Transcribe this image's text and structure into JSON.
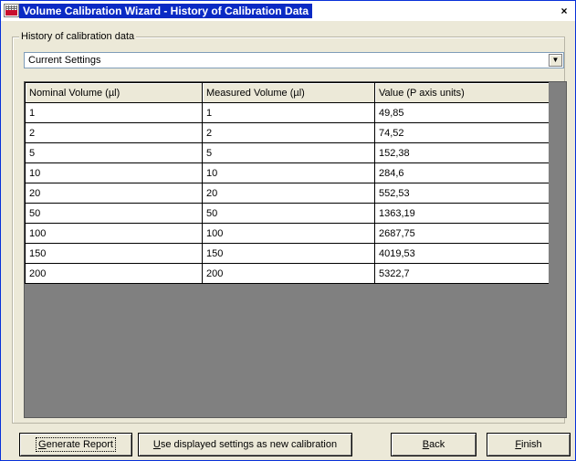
{
  "window": {
    "title": "Volume Calibration Wizard - History of Calibration Data",
    "close_glyph": "×"
  },
  "group": {
    "legend": "History of calibration data"
  },
  "combo": {
    "value": "Current Settings",
    "arrow_glyph": "▼"
  },
  "table": {
    "columns": [
      "Nominal Volume (µl)",
      "Measured Volume (µl)",
      "Value (P axis units)"
    ],
    "rows": [
      [
        "1",
        "1",
        "49,85"
      ],
      [
        "2",
        "2",
        "74,52"
      ],
      [
        "5",
        "5",
        "152,38"
      ],
      [
        "10",
        "10",
        "284,6"
      ],
      [
        "20",
        "20",
        "552,53"
      ],
      [
        "50",
        "50",
        "1363,19"
      ],
      [
        "100",
        "100",
        "2687,75"
      ],
      [
        "150",
        "150",
        "4019,53"
      ],
      [
        "200",
        "200",
        "5322,7"
      ]
    ]
  },
  "buttons": {
    "generate_report": {
      "mnemonic": "G",
      "rest": "enerate Report"
    },
    "use_settings": {
      "mnemonic": "U",
      "rest": "se displayed settings as new calibration"
    },
    "back": {
      "mnemonic": "B",
      "rest": "ack"
    },
    "finish": {
      "mnemonic": "F",
      "rest": "inish"
    }
  }
}
